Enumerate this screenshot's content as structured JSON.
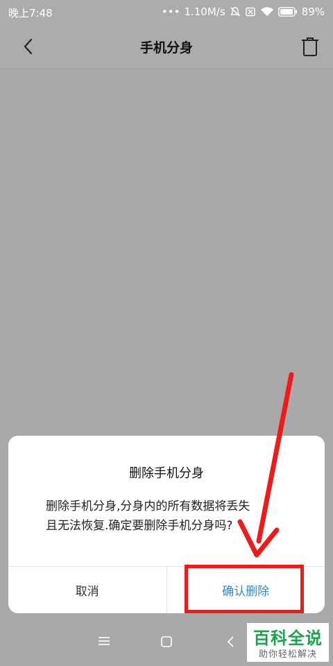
{
  "status_bar": {
    "time": "晚上7:48",
    "dots": "•••",
    "speed": "1.10M/s",
    "battery": "89%",
    "icons": [
      "alarm-off-icon",
      "no-sim-icon",
      "wifi-icon",
      "battery-icon"
    ]
  },
  "title_bar": {
    "title": "手机分身",
    "back_icon": "chevron-left-icon",
    "trash_icon": "trash-icon"
  },
  "dialog": {
    "title": "删除手机分身",
    "message_line1": "删除手机分身,分身内的所有数据将丢失",
    "message_line2": "且无法恢复.确定要删除手机分身吗?",
    "cancel_label": "取消",
    "confirm_label": "确认删除"
  },
  "nav_bar": {
    "icons": [
      "menu-icon",
      "home-icon",
      "back-icon"
    ]
  },
  "watermark": {
    "logo_text": "百科全说",
    "slogan": "助你轻松解决"
  },
  "colors": {
    "overlay": "#a9a9a9",
    "confirm": "#2f8ad8",
    "highlight": "#ef1a1a",
    "watermark_green": "#1aa34a"
  }
}
